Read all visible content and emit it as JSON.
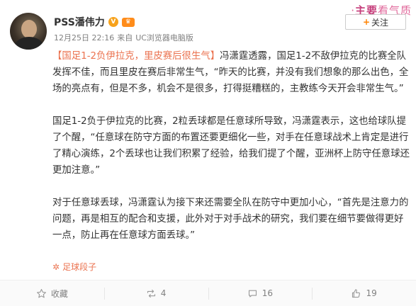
{
  "watermark": {
    "prefix": "·",
    "emph": "主要",
    "rest": "看气质"
  },
  "user": {
    "name": "PSS潘伟力",
    "verified_glyph": "V",
    "vip_glyph": "♛"
  },
  "meta": {
    "date": "12月25日 22:16",
    "source_prefix": "来自",
    "client": "UC浏览器电脑版"
  },
  "follow": {
    "plus": "+",
    "label": "关注"
  },
  "post": {
    "hashtag": "【国足1-2负伊拉克，里皮赛后很生气】",
    "p1": "冯潇霆透露，国足1-2不敌伊拉克的比赛全队发挥不佳，而且里皮在赛后非常生气，“昨天的比赛，并没有我们想象的那么出色，全场的亮点有，但是不多，机会不是很多，打得挺糟糕的，主教练今天开会非常生气。”",
    "p2": "国足1-2负于伊拉克的比赛，2粒丢球都是任意球所导致，冯潇霆表示，这也给球队提了个醒，“任意球在防守方面的布置还要更细化一些，对手在任意球战术上肯定是进行了精心演练，2个丢球也让我们积累了经验，给我们提了个醒，亚洲杯上防守任意球还更加注意。”",
    "p3": "对于任意球丢球，冯潇霆认为接下来还需要全队在防守中更加小心，“首先是注意力的问题，再是相互的配合和支援，此外对于对手战术的研究，我们要在细节要做得更好一点，防止再在任意球方面丢球。”"
  },
  "source_tag": {
    "glyph": "✲",
    "label": "足球段子"
  },
  "actions": {
    "collect_label": "收藏",
    "repost_count": "4",
    "comment_count": "16",
    "like_count": "19"
  },
  "colors": {
    "accent": "#eb7350",
    "follow_plus": "#ff8200",
    "text": "#333333",
    "meta": "#808080"
  }
}
